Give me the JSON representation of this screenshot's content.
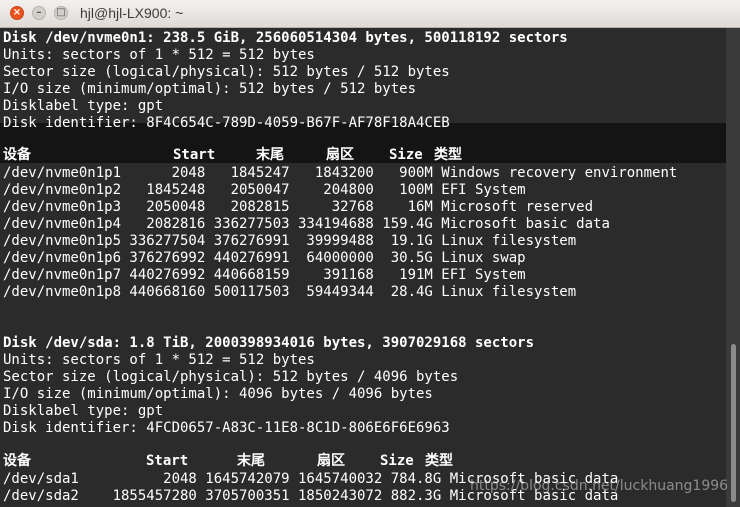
{
  "window": {
    "title": "hjl@hjl-LX900: ~",
    "close_glyph": "×",
    "min_glyph": "–",
    "max_glyph": "□"
  },
  "colors": {
    "titlebar_bg": "#dedad6",
    "terminal_bg": "#2b2b2b",
    "terminal_fg": "#ffffff",
    "close_button": "#e95420"
  },
  "disk1": {
    "lines": [
      "Disk /dev/nvme0n1: 238.5 GiB, 256060514304 bytes, 500118192 sectors",
      "Units: sectors of 1 * 512 = 512 bytes",
      "Sector size (logical/physical): 512 bytes / 512 bytes",
      "I/O size (minimum/optimal): 512 bytes / 512 bytes",
      "Disklabel type: gpt",
      "Disk identifier: 8F4C654C-789D-4059-B67F-AF78F18A4CEB"
    ],
    "headers": [
      "设备",
      "Start",
      "末尾",
      "扇区",
      "Size",
      "类型"
    ],
    "rows": [
      "/dev/nvme0n1p1      2048   1845247   1843200   900M Windows recovery environment",
      "/dev/nvme0n1p2   1845248   2050047    204800   100M EFI System",
      "/dev/nvme0n1p3   2050048   2082815     32768    16M Microsoft reserved",
      "/dev/nvme0n1p4   2082816 336277503 334194688 159.4G Microsoft basic data",
      "/dev/nvme0n1p5 336277504 376276991  39999488  19.1G Linux filesystem",
      "/dev/nvme0n1p6 376276992 440276991  64000000  30.5G Linux swap",
      "/dev/nvme0n1p7 440276992 440668159    391168   191M EFI System",
      "/dev/nvme0n1p8 440668160 500117503  59449344  28.4G Linux filesystem"
    ]
  },
  "disk2": {
    "lines": [
      "Disk /dev/sda: 1.8 TiB, 2000398934016 bytes, 3907029168 sectors",
      "Units: sectors of 1 * 512 = 512 bytes",
      "Sector size (logical/physical): 512 bytes / 4096 bytes",
      "I/O size (minimum/optimal): 4096 bytes / 4096 bytes",
      "Disklabel type: gpt",
      "Disk identifier: 4FCD0657-A83C-11E8-8C1D-806E6F6E6963"
    ],
    "headers": [
      "设备",
      "Start",
      "末尾",
      "扇区",
      "Size",
      "类型"
    ],
    "rows": [
      "/dev/sda1          2048 1645742079 1645740032 784.8G Microsoft basic data",
      "/dev/sda2    1855457280 3705700351 1850243072 882.3G Microsoft basic data"
    ]
  },
  "watermark": "https://blog.csdn.net/luckhuang1996"
}
